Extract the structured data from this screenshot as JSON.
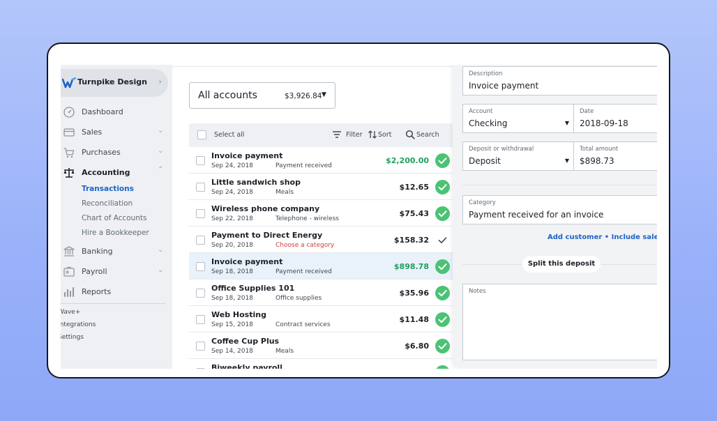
{
  "business": {
    "name": "Turnpike Design"
  },
  "sidebar": {
    "items": [
      {
        "label": "Dashboard"
      },
      {
        "label": "Sales"
      },
      {
        "label": "Purchases"
      },
      {
        "label": "Accounting"
      },
      {
        "label": "Banking"
      },
      {
        "label": "Payroll"
      },
      {
        "label": "Reports"
      }
    ],
    "accounting_sub": [
      {
        "label": "Transactions"
      },
      {
        "label": "Reconciliation"
      },
      {
        "label": "Chart of Accounts"
      },
      {
        "label": "Hire a Bookkeeper"
      }
    ],
    "footer_links": [
      {
        "label": "Wave+"
      },
      {
        "label": "Integrations"
      },
      {
        "label": "Settings"
      }
    ]
  },
  "account_select": {
    "label": "All accounts",
    "balance": "$3,926.84"
  },
  "list_header": {
    "select_all": "Select all",
    "filter": "Filter",
    "sort": "Sort",
    "search": "Search"
  },
  "transactions": [
    {
      "name": "Invoice payment",
      "date": "Sep 24, 2018",
      "category": "Payment received",
      "amount": "$2,200.00"
    },
    {
      "name": "Little sandwich shop",
      "date": "Sep 24, 2018",
      "category": "Meals",
      "amount": "$12.65"
    },
    {
      "name": "Wireless phone company",
      "date": "Sep 22, 2018",
      "category": "Telephone - wireless",
      "amount": "$75.43"
    },
    {
      "name": "Payment to Direct Energy",
      "date": "Sep 20, 2018",
      "category": "Choose a category",
      "amount": "$158.32"
    },
    {
      "name": "Invoice payment",
      "date": "Sep 18, 2018",
      "category": "Payment received",
      "amount": "$898.78"
    },
    {
      "name": "Office Supplies 101",
      "date": "Sep 18, 2018",
      "category": "Office supplies",
      "amount": "$35.96"
    },
    {
      "name": "Web Hosting",
      "date": "Sep 15, 2018",
      "category": "Contract services",
      "amount": "$11.48"
    },
    {
      "name": "Coffee Cup Plus",
      "date": "Sep 14, 2018",
      "category": "Meals",
      "amount": "$6.80"
    },
    {
      "name": "Biweekly payroll",
      "date": "",
      "category": "",
      "amount": ""
    }
  ],
  "detail": {
    "description": {
      "label": "Description",
      "value": "Invoice payment"
    },
    "account": {
      "label": "Account",
      "value": "Checking"
    },
    "date": {
      "label": "Date",
      "value": "2018-09-18"
    },
    "type": {
      "label": "Deposit or withdrawal",
      "value": "Deposit"
    },
    "total": {
      "label": "Total amount",
      "value": "$898.73"
    },
    "category": {
      "label": "Category",
      "value": "Payment received for an invoice"
    },
    "add_links": "Add customer • Include sales tax",
    "split_label": "Split this deposit",
    "notes_label": "Notes"
  },
  "colors": {
    "accent": "#1e64c8",
    "positive": "#22a05b",
    "warning": "#d43b3b",
    "check": "#4cc274",
    "background": "#a8bdfa"
  },
  "icons": [
    "wave-logo-icon",
    "dashboard-icon",
    "sales-icon",
    "purchases-icon",
    "accounting-scale-icon",
    "banking-icon",
    "payroll-icon",
    "reports-icon",
    "filter-icon",
    "sort-icon",
    "search-icon",
    "check-circle-icon",
    "check-icon",
    "chevron-down-icon"
  ]
}
